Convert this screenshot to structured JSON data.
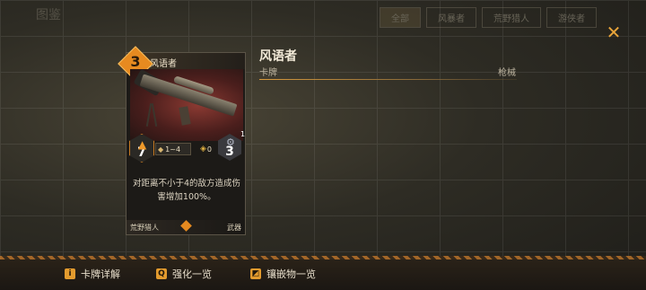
{
  "background": {
    "header_title": "图鉴",
    "tabs": [
      "全部",
      "风暴者",
      "荒野猎人",
      "游侠者"
    ]
  },
  "close_icon": "close-icon",
  "card": {
    "cost": "3",
    "name": "风语者",
    "attack": "7",
    "range": "1~4",
    "ammo": "0",
    "defense": "3",
    "defense_corner": "1",
    "description": "对距离不小于4的敌方造成伤害增加100%。",
    "faction": "荒野猎人",
    "type": "武器"
  },
  "detail": {
    "title": "风语者",
    "subtitle": "卡牌",
    "category": "枪械"
  },
  "bottom_bar": {
    "items": [
      {
        "icon": "info-icon",
        "glyph": "i",
        "label": "卡牌详解"
      },
      {
        "icon": "search-icon",
        "glyph": "Q",
        "label": "强化一览"
      },
      {
        "icon": "inlay-icon",
        "glyph": "◩",
        "label": "镶嵌物一览"
      }
    ]
  },
  "colors": {
    "accent": "#e68a20",
    "text": "#e9e0cf"
  }
}
